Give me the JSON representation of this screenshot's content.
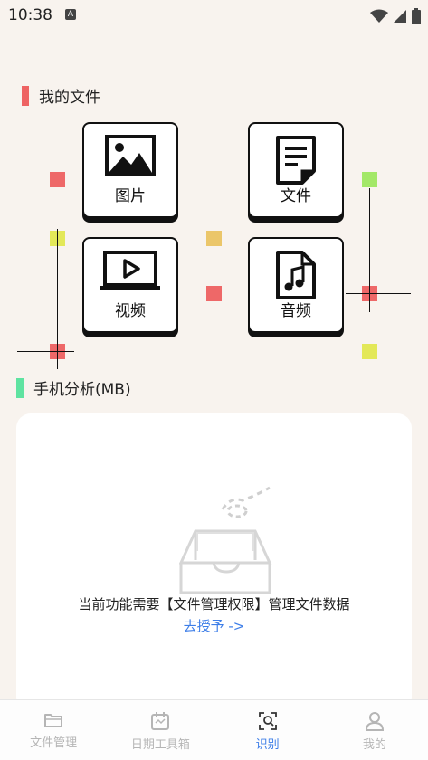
{
  "status_bar": {
    "time": "10:38",
    "notification_glyph": "A"
  },
  "sections": {
    "my_files": {
      "title": "我的文件",
      "accent": "#ee6363"
    },
    "phone_analysis": {
      "title": "手机分析(MB)",
      "accent": "#5fe3a1"
    }
  },
  "tiles": {
    "images": {
      "label": "图片",
      "icon": "image-icon"
    },
    "files": {
      "label": "文件",
      "icon": "document-icon"
    },
    "videos": {
      "label": "视频",
      "icon": "video-icon"
    },
    "audio": {
      "label": "音频",
      "icon": "music-icon"
    }
  },
  "card": {
    "message": "当前功能需要【文件管理权限】管理文件数据",
    "link": "去授予 ->"
  },
  "tabbar": {
    "tabs": [
      {
        "label": "文件管理",
        "icon": "folder-icon"
      },
      {
        "label": "日期工具箱",
        "icon": "calendar-icon"
      },
      {
        "label": "识别",
        "icon": "scan-search-icon"
      },
      {
        "label": "我的",
        "icon": "person-icon"
      }
    ],
    "active": "识别"
  },
  "colors": {
    "red_square": "#ee6868",
    "yellow_square": "#e3e858",
    "orange_square": "#ebc66a",
    "green_square": "#a3e868",
    "link": "#3d7ee8"
  }
}
